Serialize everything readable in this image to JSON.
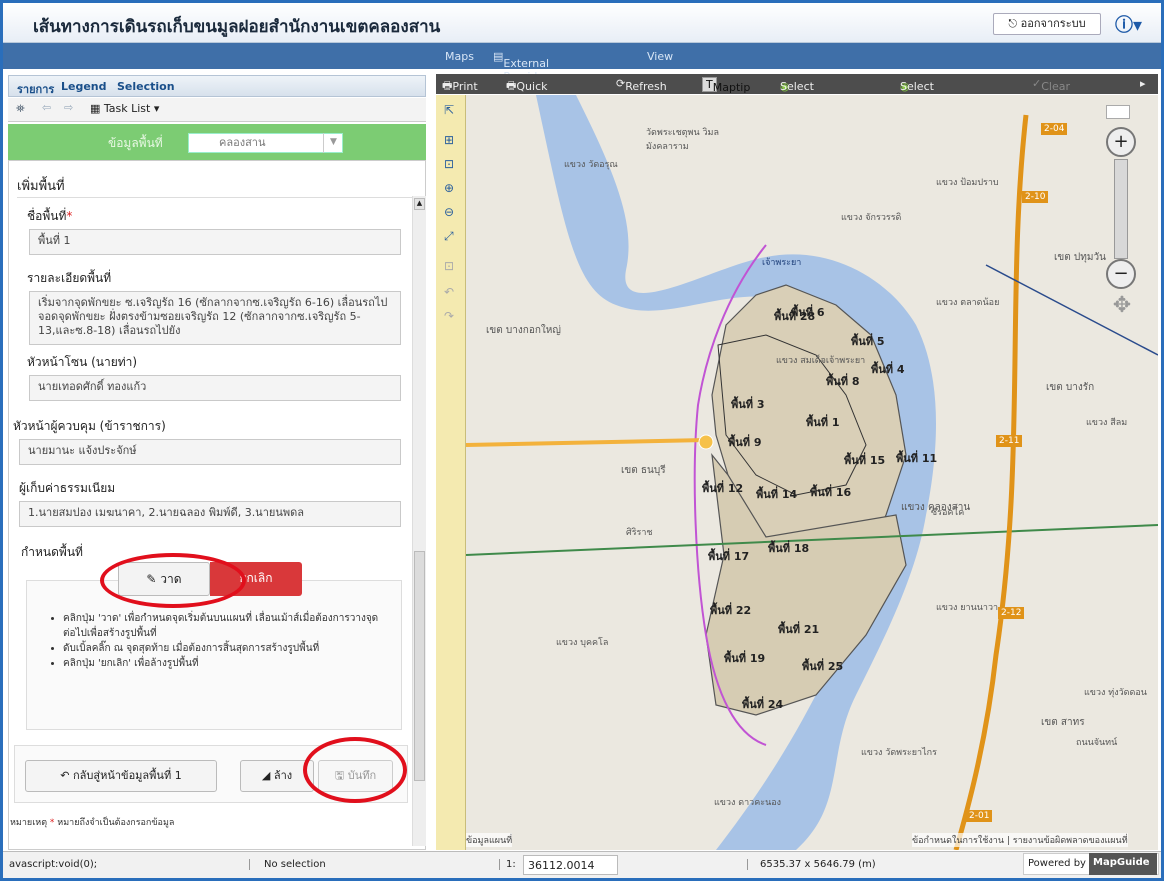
{
  "app": {
    "title": "เส้นทางการเดินรถเก็บขนมูลฝอยสำนักงานเขตคลองสาน",
    "logout_label": "ออกจากระบบ",
    "info_icon": "info-icon"
  },
  "menubar": {
    "maps": "Maps",
    "external": "External Providers",
    "view": "View"
  },
  "leftpanel": {
    "tabs": [
      "รายการ",
      "Legend",
      "Selection"
    ],
    "tasklist": "Task List ▾",
    "district_label": "ข้อมูลพื้นที่",
    "district_value": "คลองสาน",
    "section_title": "เพิ่มพื้นที่",
    "area_name_label": "ชื่อพื้นที่",
    "required_mark": "*",
    "area_name_value": "พื้นที่ 1",
    "detail_label": "รายละเอียดพื้นที่",
    "detail_value": "เริ่มจากจุดพักขยะ ซ.เจริญรัถ 16 (ซักลากจากซ.เจริญรัถ 6-16) เลื่อนรถไปจอดจุดพักขยะ ฝั่งตรงข้ามซอยเจริญรัถ 12 (ซักลากจากซ.เจริญรัถ 5-13,และซ.8-18) เลื่อนรถไปยัง",
    "zone_head_label": "หัวหน้าโซน (นายท่า)",
    "zone_head_value": "นายเทอดศักดิ์ ทองแก้ว",
    "supervisor_label": "หัวหน้าผู้ควบคุม (ข้าราชการ)",
    "supervisor_value": "นายมานะ แจ้งประจักษ์",
    "collector_label": "ผู้เก็บค่าธรรมเนียม",
    "collector_value": "1.นายสมปอง เมฆนาคา, 2.นายฉลอง พิมพ์ดี, 3.นายนพดล",
    "define_area_label": "กำหนดพื้นที่",
    "draw_button": "วาด",
    "cancel_button": "ยกเลิก",
    "help": [
      "คลิกปุ่ม 'วาด' เพื่อกำหนดจุดเริ่มต้นบนแผนที่ เลื่อนเม้าส์เมื่อต้องการวางจุดต่อไปเพื่อสร้างรูปพื้นที่",
      "ดับเบิ้ลคลิ๊ก ณ จุดสุดท้าย เมื่อต้องการสิ้นสุดการสร้างรูปพื้นที่",
      "คลิกปุ่ม 'ยกเลิก' เพื่อล้างรูปพื้นที่"
    ],
    "back_button": "กลับสู่หน้าข้อมูลพื้นที่ 1",
    "clear_button": "ล้าง",
    "save_button": "บันทึก",
    "note_prefix": "หมายเหตุ",
    "note_text": "หมายถึงจำเป็นต้องกรอกข้อมูล"
  },
  "maptoolbar": [
    "Print",
    "Quick Plot",
    "Refresh",
    "Maptip",
    "Select Radius",
    "Select Polygon",
    "Clear Se"
  ],
  "map": {
    "areas": [
      "พื้นที่ 1",
      "พื้นที่ 3",
      "พื้นที่ 4",
      "พื้นที่ 5",
      "พื้นที่ 6",
      "พื้นที่ 8",
      "พื้นที่ 9",
      "พื้นที่ 11",
      "พื้นที่ 12",
      "พื้นที่ 14",
      "พื้นที่ 15",
      "พื้นที่ 16",
      "พื้นที่ 17",
      "พื้นที่ 18",
      "พื้นที่ 19",
      "พื้นที่ 21",
      "พื้นที่ 22",
      "พื้นที่ 24",
      "พื้นที่ 25",
      "พื้นที่ 28"
    ],
    "place_labels": [
      "เขต บางกอกใหญ่",
      "เขต ธนบุรี",
      "เขต บางรัก",
      "เขต สาทร",
      "แขวง คลองสาน",
      "วัดพระเชตุพน วิมลมังคลาราม",
      "แขวง วัดอรุณ",
      "แขวง บุคคโล",
      "แขวง ยานนาวา",
      "แขวง ตลาดน้อย",
      "ศิริราช",
      "แขวง ป้อมปราบ",
      "แขวง จักรวรรดิ",
      "แขวง สมเด็จเจ้าพระยา",
      "เจ้าพระยา",
      "เขต ปทุมวัน",
      "แขวง สีลม",
      "แขวง ทุ่งวัดดอน",
      "ถนนจันทน์",
      "แขวง วัดพระยาไกร",
      "แขวง ดาวคะนอง",
      "ซีรอคโค"
    ],
    "road_badges": [
      "2-04",
      "2-10",
      "2-11",
      "2-12",
      "2-01"
    ],
    "copyright_left": "ข้อมูลแผนที่",
    "copyright_right": "ข้อกำหนดในการใช้งาน | รายงานข้อผิดพลาดของแผนที่"
  },
  "statusbar": {
    "left": "avascript:void(0);",
    "selection": "No selection",
    "scale_prefix": "1:",
    "scale": "36112.0014",
    "extent": "6535.37 x 5646.79 (m)",
    "powered": "Powered by",
    "brand": "MapGuide"
  }
}
